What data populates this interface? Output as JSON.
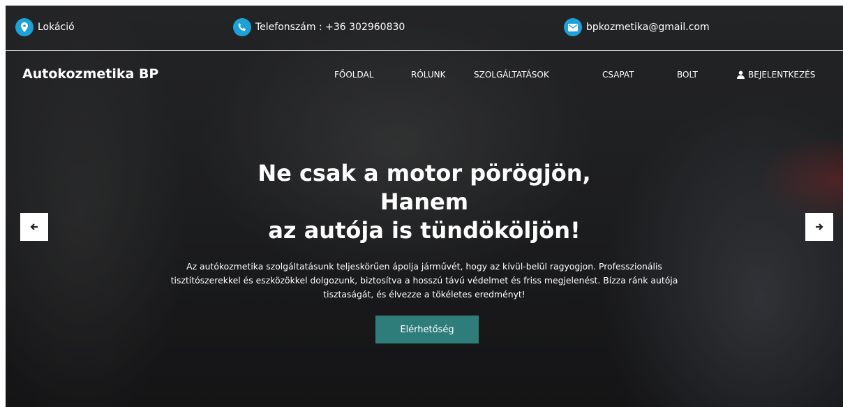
{
  "contact": {
    "location": "Lokáció",
    "phone": "Telefonszám : +36 302960830",
    "email": "bpkozmetika@gmail.com"
  },
  "brand": "Autokozmetika BP",
  "nav": {
    "home": "FŐOLDAL",
    "about": "RÓLUNK",
    "services": "SZOLGÁLTATÁSOK",
    "team": "CSAPAT",
    "shop": "BOLT",
    "login": "BEJELENTKEZÉS"
  },
  "hero": {
    "headline_lines": [
      "Ne csak a motor pörögjön,",
      "Hanem",
      "az autója is tündököljön!"
    ],
    "description_lines": [
      "Az autókozmetika szolgáltatásunk teljeskörűen ápolja járművét, hogy az kívül-belül ragyogjon. Professzionális",
      "tisztítószerekkel és eszközökkel dolgozunk, biztosítva a hosszú távú védelmet és friss megjelenést. Bízza ránk autója",
      "tisztaságát, és élvezze a tökéletes eredményt!"
    ],
    "cta_label": "Elérhetőség"
  },
  "icons": {
    "location": "map-marker-icon",
    "phone": "phone-icon",
    "email": "envelope-icon",
    "login": "user-icon",
    "prev": "arrow-left-icon",
    "next": "arrow-right-icon"
  },
  "colors": {
    "contact_icon_bg": "#1ea1d6",
    "cta_bg": "#2f7d7a"
  }
}
